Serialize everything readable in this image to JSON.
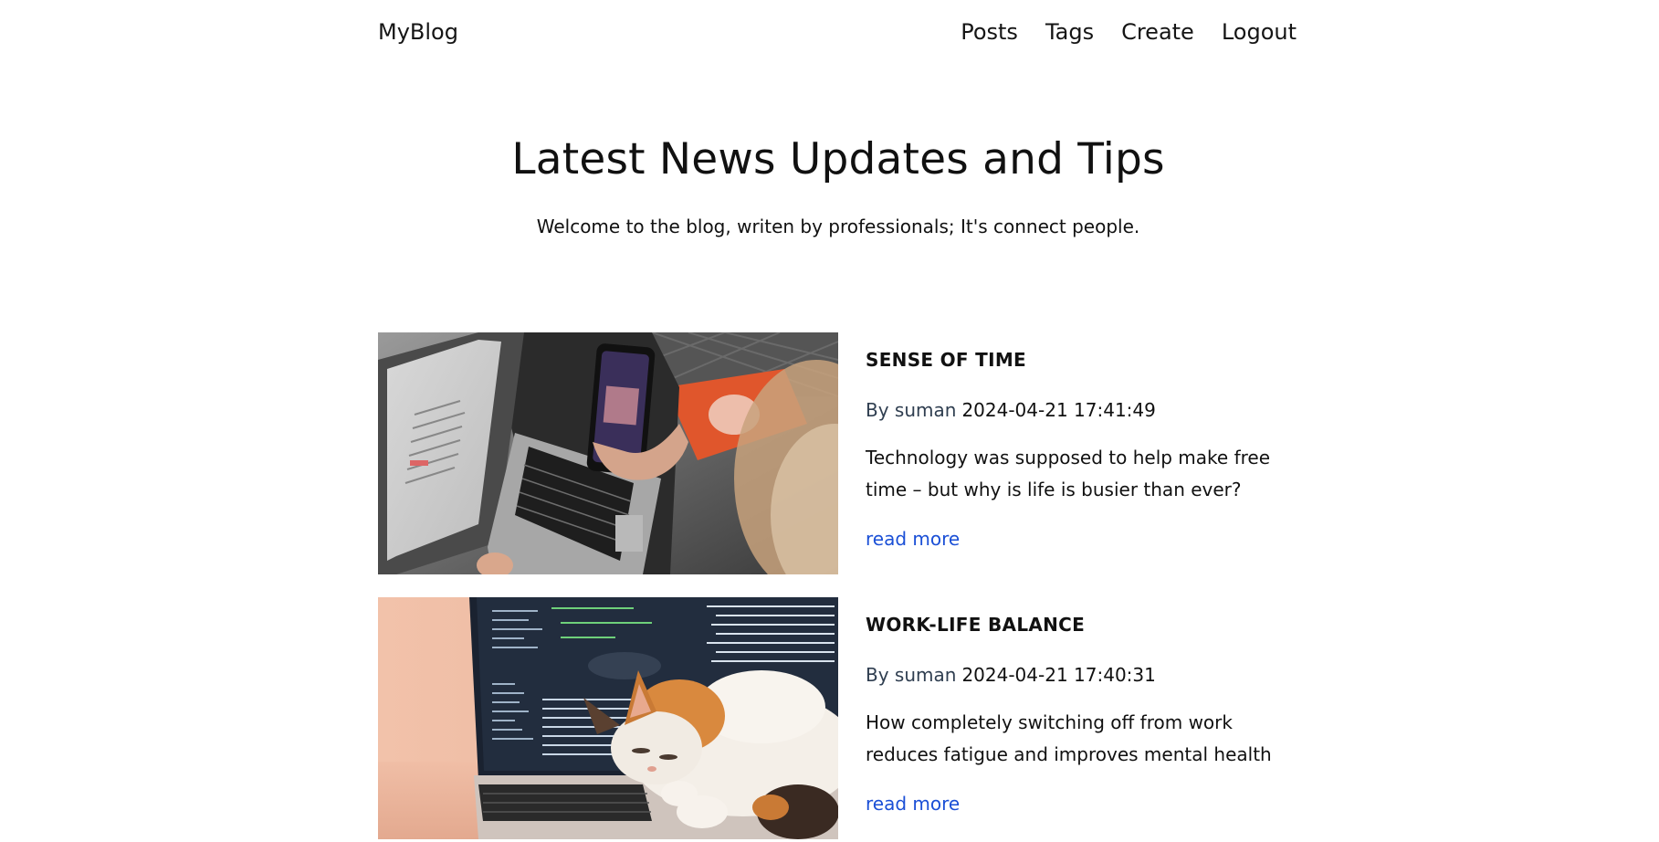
{
  "header": {
    "brand": "MyBlog",
    "nav": [
      "Posts",
      "Tags",
      "Create",
      "Logout"
    ]
  },
  "hero": {
    "title": "Latest News Updates and Tips",
    "subtitle": "Welcome to the blog, writen by professionals; It's connect people."
  },
  "posts": [
    {
      "title": "SENSE OF TIME",
      "author": "By suman",
      "date": "2024-04-21 17:41:49",
      "excerpt": "Technology was supposed to help make free time – but why is life is busier than ever?",
      "link": "read more",
      "image": "laptop-and-phone-photo"
    },
    {
      "title": "WORK-LIFE BALANCE",
      "author": "By suman",
      "date": "2024-04-21 17:40:31",
      "excerpt": "How completely switching off from work reduces fatigue and improves mental health",
      "link": "read more",
      "image": "cat-on-laptop-photo"
    }
  ],
  "colors": {
    "link": "#1a4fd6",
    "author": "#2f3e50",
    "text": "#111111",
    "background": "#ffffff"
  }
}
